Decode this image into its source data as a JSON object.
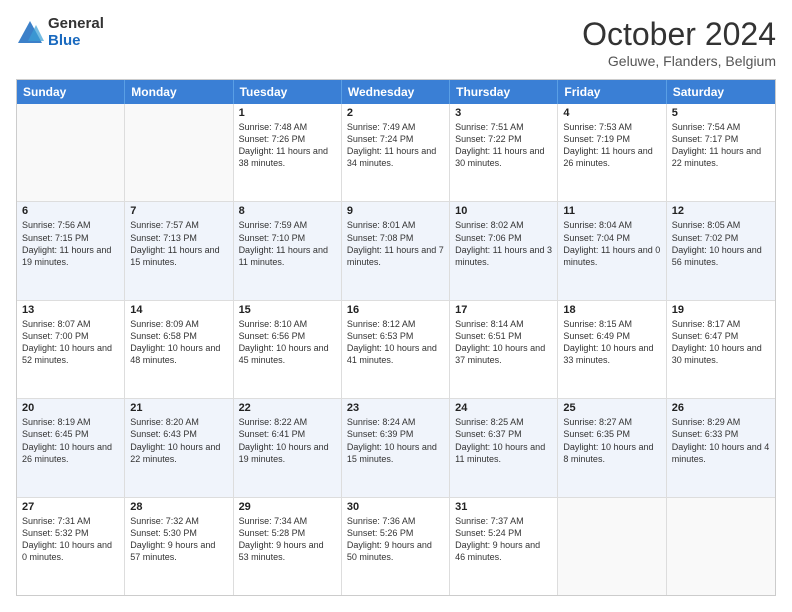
{
  "logo": {
    "general": "General",
    "blue": "Blue"
  },
  "header": {
    "month": "October 2024",
    "location": "Geluwe, Flanders, Belgium"
  },
  "weekdays": [
    "Sunday",
    "Monday",
    "Tuesday",
    "Wednesday",
    "Thursday",
    "Friday",
    "Saturday"
  ],
  "rows": [
    [
      {
        "day": "",
        "sunrise": "",
        "sunset": "",
        "daylight": "",
        "alt": false
      },
      {
        "day": "",
        "sunrise": "",
        "sunset": "",
        "daylight": "",
        "alt": false
      },
      {
        "day": "1",
        "sunrise": "Sunrise: 7:48 AM",
        "sunset": "Sunset: 7:26 PM",
        "daylight": "Daylight: 11 hours and 38 minutes.",
        "alt": false
      },
      {
        "day": "2",
        "sunrise": "Sunrise: 7:49 AM",
        "sunset": "Sunset: 7:24 PM",
        "daylight": "Daylight: 11 hours and 34 minutes.",
        "alt": false
      },
      {
        "day": "3",
        "sunrise": "Sunrise: 7:51 AM",
        "sunset": "Sunset: 7:22 PM",
        "daylight": "Daylight: 11 hours and 30 minutes.",
        "alt": false
      },
      {
        "day": "4",
        "sunrise": "Sunrise: 7:53 AM",
        "sunset": "Sunset: 7:19 PM",
        "daylight": "Daylight: 11 hours and 26 minutes.",
        "alt": false
      },
      {
        "day": "5",
        "sunrise": "Sunrise: 7:54 AM",
        "sunset": "Sunset: 7:17 PM",
        "daylight": "Daylight: 11 hours and 22 minutes.",
        "alt": false
      }
    ],
    [
      {
        "day": "6",
        "sunrise": "Sunrise: 7:56 AM",
        "sunset": "Sunset: 7:15 PM",
        "daylight": "Daylight: 11 hours and 19 minutes.",
        "alt": true
      },
      {
        "day": "7",
        "sunrise": "Sunrise: 7:57 AM",
        "sunset": "Sunset: 7:13 PM",
        "daylight": "Daylight: 11 hours and 15 minutes.",
        "alt": true
      },
      {
        "day": "8",
        "sunrise": "Sunrise: 7:59 AM",
        "sunset": "Sunset: 7:10 PM",
        "daylight": "Daylight: 11 hours and 11 minutes.",
        "alt": true
      },
      {
        "day": "9",
        "sunrise": "Sunrise: 8:01 AM",
        "sunset": "Sunset: 7:08 PM",
        "daylight": "Daylight: 11 hours and 7 minutes.",
        "alt": true
      },
      {
        "day": "10",
        "sunrise": "Sunrise: 8:02 AM",
        "sunset": "Sunset: 7:06 PM",
        "daylight": "Daylight: 11 hours and 3 minutes.",
        "alt": true
      },
      {
        "day": "11",
        "sunrise": "Sunrise: 8:04 AM",
        "sunset": "Sunset: 7:04 PM",
        "daylight": "Daylight: 11 hours and 0 minutes.",
        "alt": true
      },
      {
        "day": "12",
        "sunrise": "Sunrise: 8:05 AM",
        "sunset": "Sunset: 7:02 PM",
        "daylight": "Daylight: 10 hours and 56 minutes.",
        "alt": true
      }
    ],
    [
      {
        "day": "13",
        "sunrise": "Sunrise: 8:07 AM",
        "sunset": "Sunset: 7:00 PM",
        "daylight": "Daylight: 10 hours and 52 minutes.",
        "alt": false
      },
      {
        "day": "14",
        "sunrise": "Sunrise: 8:09 AM",
        "sunset": "Sunset: 6:58 PM",
        "daylight": "Daylight: 10 hours and 48 minutes.",
        "alt": false
      },
      {
        "day": "15",
        "sunrise": "Sunrise: 8:10 AM",
        "sunset": "Sunset: 6:56 PM",
        "daylight": "Daylight: 10 hours and 45 minutes.",
        "alt": false
      },
      {
        "day": "16",
        "sunrise": "Sunrise: 8:12 AM",
        "sunset": "Sunset: 6:53 PM",
        "daylight": "Daylight: 10 hours and 41 minutes.",
        "alt": false
      },
      {
        "day": "17",
        "sunrise": "Sunrise: 8:14 AM",
        "sunset": "Sunset: 6:51 PM",
        "daylight": "Daylight: 10 hours and 37 minutes.",
        "alt": false
      },
      {
        "day": "18",
        "sunrise": "Sunrise: 8:15 AM",
        "sunset": "Sunset: 6:49 PM",
        "daylight": "Daylight: 10 hours and 33 minutes.",
        "alt": false
      },
      {
        "day": "19",
        "sunrise": "Sunrise: 8:17 AM",
        "sunset": "Sunset: 6:47 PM",
        "daylight": "Daylight: 10 hours and 30 minutes.",
        "alt": false
      }
    ],
    [
      {
        "day": "20",
        "sunrise": "Sunrise: 8:19 AM",
        "sunset": "Sunset: 6:45 PM",
        "daylight": "Daylight: 10 hours and 26 minutes.",
        "alt": true
      },
      {
        "day": "21",
        "sunrise": "Sunrise: 8:20 AM",
        "sunset": "Sunset: 6:43 PM",
        "daylight": "Daylight: 10 hours and 22 minutes.",
        "alt": true
      },
      {
        "day": "22",
        "sunrise": "Sunrise: 8:22 AM",
        "sunset": "Sunset: 6:41 PM",
        "daylight": "Daylight: 10 hours and 19 minutes.",
        "alt": true
      },
      {
        "day": "23",
        "sunrise": "Sunrise: 8:24 AM",
        "sunset": "Sunset: 6:39 PM",
        "daylight": "Daylight: 10 hours and 15 minutes.",
        "alt": true
      },
      {
        "day": "24",
        "sunrise": "Sunrise: 8:25 AM",
        "sunset": "Sunset: 6:37 PM",
        "daylight": "Daylight: 10 hours and 11 minutes.",
        "alt": true
      },
      {
        "day": "25",
        "sunrise": "Sunrise: 8:27 AM",
        "sunset": "Sunset: 6:35 PM",
        "daylight": "Daylight: 10 hours and 8 minutes.",
        "alt": true
      },
      {
        "day": "26",
        "sunrise": "Sunrise: 8:29 AM",
        "sunset": "Sunset: 6:33 PM",
        "daylight": "Daylight: 10 hours and 4 minutes.",
        "alt": true
      }
    ],
    [
      {
        "day": "27",
        "sunrise": "Sunrise: 7:31 AM",
        "sunset": "Sunset: 5:32 PM",
        "daylight": "Daylight: 10 hours and 0 minutes.",
        "alt": false
      },
      {
        "day": "28",
        "sunrise": "Sunrise: 7:32 AM",
        "sunset": "Sunset: 5:30 PM",
        "daylight": "Daylight: 9 hours and 57 minutes.",
        "alt": false
      },
      {
        "day": "29",
        "sunrise": "Sunrise: 7:34 AM",
        "sunset": "Sunset: 5:28 PM",
        "daylight": "Daylight: 9 hours and 53 minutes.",
        "alt": false
      },
      {
        "day": "30",
        "sunrise": "Sunrise: 7:36 AM",
        "sunset": "Sunset: 5:26 PM",
        "daylight": "Daylight: 9 hours and 50 minutes.",
        "alt": false
      },
      {
        "day": "31",
        "sunrise": "Sunrise: 7:37 AM",
        "sunset": "Sunset: 5:24 PM",
        "daylight": "Daylight: 9 hours and 46 minutes.",
        "alt": false
      },
      {
        "day": "",
        "sunrise": "",
        "sunset": "",
        "daylight": "",
        "alt": false
      },
      {
        "day": "",
        "sunrise": "",
        "sunset": "",
        "daylight": "",
        "alt": false
      }
    ]
  ]
}
